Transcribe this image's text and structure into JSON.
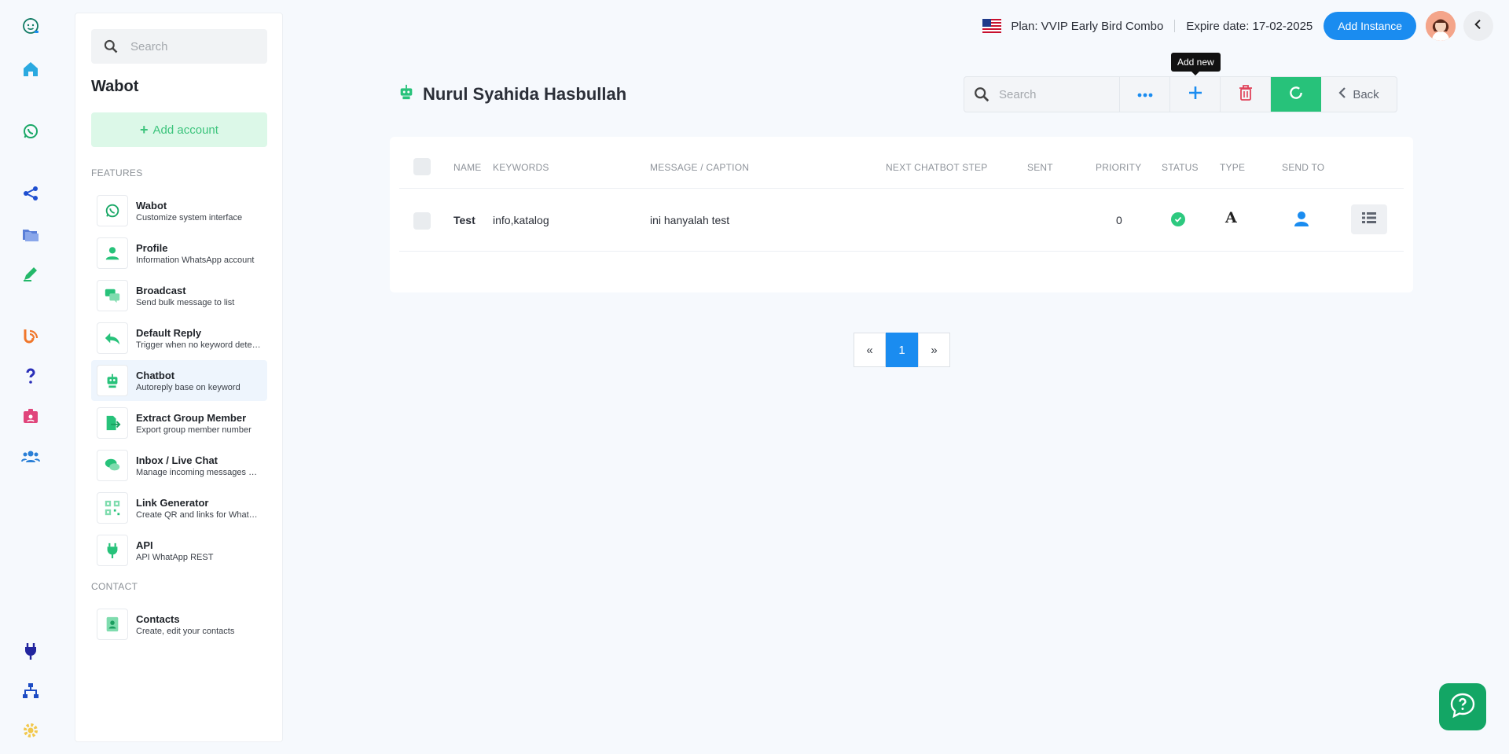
{
  "rail": {
    "icons": [
      "logo-bot-icon",
      "home-icon",
      "whatsapp-icon",
      "share-nodes-icon",
      "folders-icon",
      "edit-pen-icon",
      "blogger-icon",
      "question-icon",
      "id-badge-icon",
      "users-icon",
      "plug-icon",
      "sitemap-icon",
      "gear-icon"
    ]
  },
  "sidebar": {
    "search_placeholder": "Search",
    "title": "Wabot",
    "add_account_label": "Add account",
    "features_heading": "FEATURES",
    "contact_heading": "CONTACT",
    "items": [
      {
        "title": "Wabot",
        "subtitle": "Customize system interface",
        "icon": "whatsapp-icon"
      },
      {
        "title": "Profile",
        "subtitle": "Information WhatsApp account",
        "icon": "user-icon"
      },
      {
        "title": "Broadcast",
        "subtitle": "Send bulk message to list",
        "icon": "chat-bubbles-icon"
      },
      {
        "title": "Default Reply",
        "subtitle": "Trigger when no keyword detected",
        "icon": "reply-all-icon"
      },
      {
        "title": "Chatbot",
        "subtitle": "Autoreply base on keyword",
        "icon": "robot-icon"
      },
      {
        "title": "Extract Group Member",
        "subtitle": "Export group member number",
        "icon": "file-export-icon"
      },
      {
        "title": "Inbox / Live Chat",
        "subtitle": "Manage incoming messages and chats",
        "icon": "comments-icon"
      },
      {
        "title": "Link Generator",
        "subtitle": "Create QR and links for WhatsApp",
        "icon": "qr-code-icon"
      },
      {
        "title": "API",
        "subtitle": "API WhatApp REST",
        "icon": "plug-icon"
      }
    ],
    "contacts": {
      "title": "Contacts",
      "subtitle": "Create, edit your contacts",
      "icon": "address-book-icon"
    }
  },
  "header": {
    "plan": "Plan: VVIP Early Bird Combo",
    "expire": "Expire date: 17-02-2025",
    "add_instance_label": "Add Instance"
  },
  "page": {
    "title": "Nurul Syahida Hasbullah",
    "search_placeholder": "Search",
    "tooltip": "Add new",
    "back_label": "Back"
  },
  "table": {
    "columns": [
      "NAME",
      "KEYWORDS",
      "MESSAGE / CAPTION",
      "NEXT CHATBOT STEP",
      "SENT",
      "PRIORITY",
      "STATUS",
      "TYPE",
      "SEND TO"
    ],
    "rows": [
      {
        "name": "Test",
        "keywords": "info,katalog",
        "message": "ini hanyalah test",
        "next_step": "",
        "sent": "",
        "priority": "0",
        "type_glyph": "A"
      }
    ]
  },
  "pagination": {
    "prev": "«",
    "current": "1",
    "next": "»"
  },
  "colors": {
    "accent_blue": "#1a8cf0",
    "accent_green": "#27c27a",
    "brand_green": "#13a665",
    "danger": "#e0435a"
  }
}
